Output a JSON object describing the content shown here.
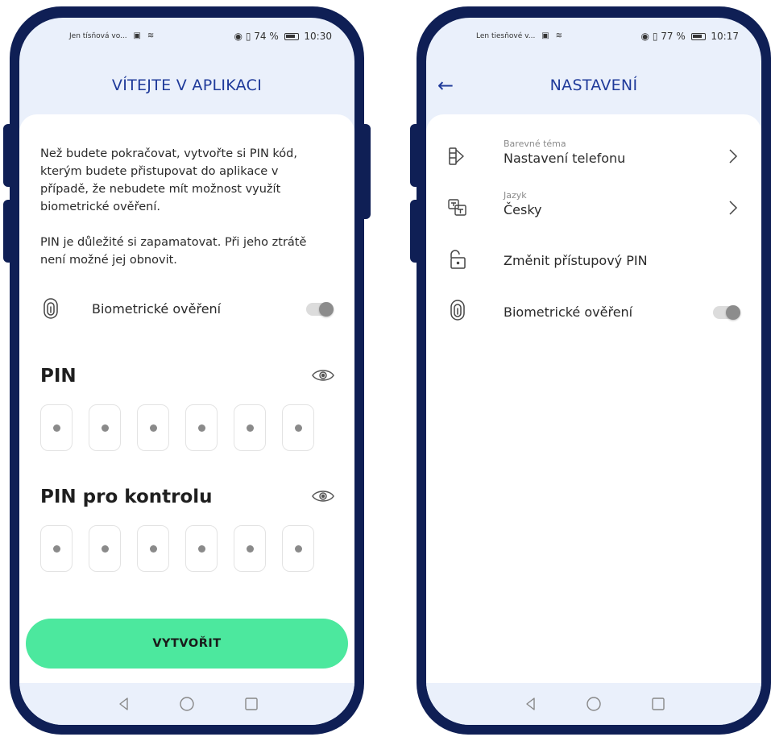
{
  "phone1": {
    "status": {
      "carrier": "Jen tísňová vo...",
      "battery": "74 %",
      "time": "10:30"
    },
    "header": {
      "title": "VÍTEJTE V APLIKACI"
    },
    "intro": {
      "para1": "Než budete pokračovat, vytvořte si PIN kód, kterým budete přistupovat do aplikace v případě, že nebudete mít možnost využít biometrické ověření.",
      "para2": "PIN je důležité si zapamatovat. Při jeho ztrátě není možné jej obnovit."
    },
    "biometric": {
      "label": "Biometrické ověření",
      "enabled": false
    },
    "pin": {
      "title": "PIN",
      "digits": 6
    },
    "pin_confirm": {
      "title": "PIN pro kontrolu",
      "digits": 6
    },
    "cta": {
      "label": "VYTVOŘIT"
    }
  },
  "phone2": {
    "status": {
      "carrier": "Len tiesňové v...",
      "battery": "77 %",
      "time": "10:17"
    },
    "header": {
      "title": "NASTAVENÍ"
    },
    "settings": [
      {
        "sub": "Barevné téma",
        "value": "Nastavení telefonu",
        "icon": "palette-icon"
      },
      {
        "sub": "Jazyk",
        "value": "Česky",
        "icon": "translate-icon"
      },
      {
        "sub": "",
        "value": "Změnit přístupový PIN",
        "icon": "unlock-icon"
      },
      {
        "sub": "",
        "value": "Biometrické ověření",
        "icon": "fingerprint-icon",
        "enabled": false
      }
    ]
  },
  "colors": {
    "frame": "#0f1f55",
    "accent": "#1f3a9a",
    "cta": "#4ce89e",
    "screen_bg": "#eaf0fb"
  }
}
